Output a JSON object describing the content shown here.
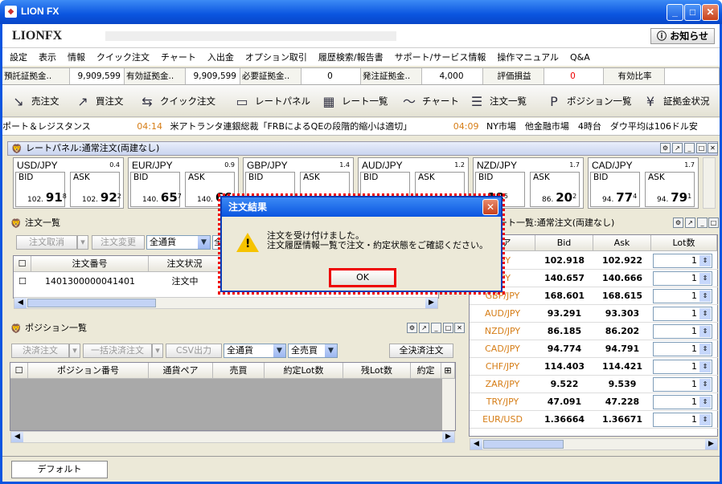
{
  "window": {
    "title": "LION FX"
  },
  "logo": {
    "text": "LIONFX",
    "notice_label": "お知らせ"
  },
  "menu": [
    "設定",
    "表示",
    "情報",
    "クイック注文",
    "チャート",
    "入出金",
    "オプション取引",
    "履歴検索/報告書",
    "サポート/サービス情報",
    "操作マニュアル",
    "Q&A"
  ],
  "info": [
    {
      "label": "預託証拠金..",
      "value": "9,909,599"
    },
    {
      "label": "有効証拠金..",
      "value": "9,909,599"
    },
    {
      "label": "必要証拠金..",
      "value": "0"
    },
    {
      "label": "発注証拠金..",
      "value": "4,000"
    },
    {
      "label": "評価損益",
      "value": "0"
    },
    {
      "label": "有効比率",
      "value": ""
    }
  ],
  "toolbar": [
    "売注文",
    "買注文",
    "クイック注文",
    "レートパネル",
    "レート一覧",
    "チャート",
    "注文一覧",
    "ポジション一覧",
    "証拠金状況"
  ],
  "ticker": {
    "t1_text": "ポート＆レジスタンス",
    "t2_time": "04:14",
    "t2_text": "米アトランタ連銀総裁「FRBによるQEの段階的縮小は適切」",
    "t3_time": "04:09",
    "t3_text": "NY市場　他金融市場　4時台　ダウ平均は106ドル安"
  },
  "rate_panel": {
    "title": "レートパネル:通常注文(両建なし)",
    "pairs": [
      {
        "pair": "USD/JPY",
        "spread": "0.4",
        "bid_pre": "102.",
        "bid_big": "91",
        "bid_sup": "8",
        "ask_pre": "102.",
        "ask_big": "92",
        "ask_sup": "2"
      },
      {
        "pair": "EUR/JPY",
        "spread": "0.9",
        "bid_pre": "140.",
        "bid_big": "65",
        "bid_sup": "7",
        "ask_pre": "140.",
        "ask_big": "66",
        "ask_sup": ""
      },
      {
        "pair": "GBP/JPY",
        "spread": "1.4",
        "bid_pre": "",
        "bid_big": "",
        "bid_sup": "",
        "ask_pre": "",
        "ask_big": "",
        "ask_sup": ""
      },
      {
        "pair": "AUD/JPY",
        "spread": "1.2",
        "bid_pre": "",
        "bid_big": "",
        "bid_sup": "",
        "ask_pre": "",
        "ask_big": "",
        "ask_sup": ""
      },
      {
        "pair": "NZD/JPY",
        "spread": "1.7",
        "bid_pre": "",
        "bid_big": "18",
        "bid_sup": "5",
        "ask_pre": "86.",
        "ask_big": "20",
        "ask_sup": "2"
      },
      {
        "pair": "CAD/JPY",
        "spread": "1.7",
        "bid_pre": "94.",
        "bid_big": "77",
        "bid_sup": "4",
        "ask_pre": "94.",
        "ask_big": "79",
        "ask_sup": "1"
      }
    ],
    "bid_label": "BID",
    "ask_label": "ASK"
  },
  "order_list": {
    "title": "注文一覧",
    "cancel": "注文取消",
    "change": "注文変更",
    "currency": "全通貨",
    "currency2": "全",
    "cols": [
      "注文番号",
      "注文状況"
    ],
    "rows": [
      {
        "id": "1401300000041401",
        "status": "注文中"
      }
    ]
  },
  "position_list": {
    "title": "ポジション一覧",
    "settle": "決済注文",
    "bulk": "一括決済注文",
    "csv": "CSV出力",
    "currency": "全通貨",
    "side": "全売買",
    "all_settle": "全決済注文",
    "cols": [
      "ポジション番号",
      "通貨ペア",
      "売買",
      "約定Lot数",
      "残Lot数",
      "約定"
    ]
  },
  "rate_list": {
    "title": "ート一覧:通常注文(両建なし)",
    "cols": [
      "ペア",
      "Bid",
      "Ask",
      "Lot数"
    ],
    "rows": [
      {
        "pair": "/JPY",
        "bid": "102.918",
        "ask": "102.922",
        "lot": "1"
      },
      {
        "pair": "/JPY",
        "bid": "140.657",
        "ask": "140.666",
        "lot": "1"
      },
      {
        "pair": "GBP/JPY",
        "bid": "168.601",
        "ask": "168.615",
        "lot": "1"
      },
      {
        "pair": "AUD/JPY",
        "bid": "93.291",
        "ask": "93.303",
        "lot": "1"
      },
      {
        "pair": "NZD/JPY",
        "bid": "86.185",
        "ask": "86.202",
        "lot": "1"
      },
      {
        "pair": "CAD/JPY",
        "bid": "94.774",
        "ask": "94.791",
        "lot": "1"
      },
      {
        "pair": "CHF/JPY",
        "bid": "114.403",
        "ask": "114.421",
        "lot": "1"
      },
      {
        "pair": "ZAR/JPY",
        "bid": "9.522",
        "ask": "9.539",
        "lot": "1"
      },
      {
        "pair": "TRY/JPY",
        "bid": "47.091",
        "ask": "47.228",
        "lot": "1"
      },
      {
        "pair": "EUR/USD",
        "bid": "1.36664",
        "ask": "1.36671",
        "lot": "1"
      }
    ]
  },
  "dialog": {
    "title": "注文結果",
    "line1": "注文を受け付けました。",
    "line2": "注文履歴情報一覧で注文・約定状態をご確認ください。",
    "ok": "OK"
  },
  "bottom_tab": "デフォルト",
  "colors": {
    "title_blue": "#0a55e0",
    "highlight": "#e00000",
    "pair_orange": "#d67d16"
  }
}
